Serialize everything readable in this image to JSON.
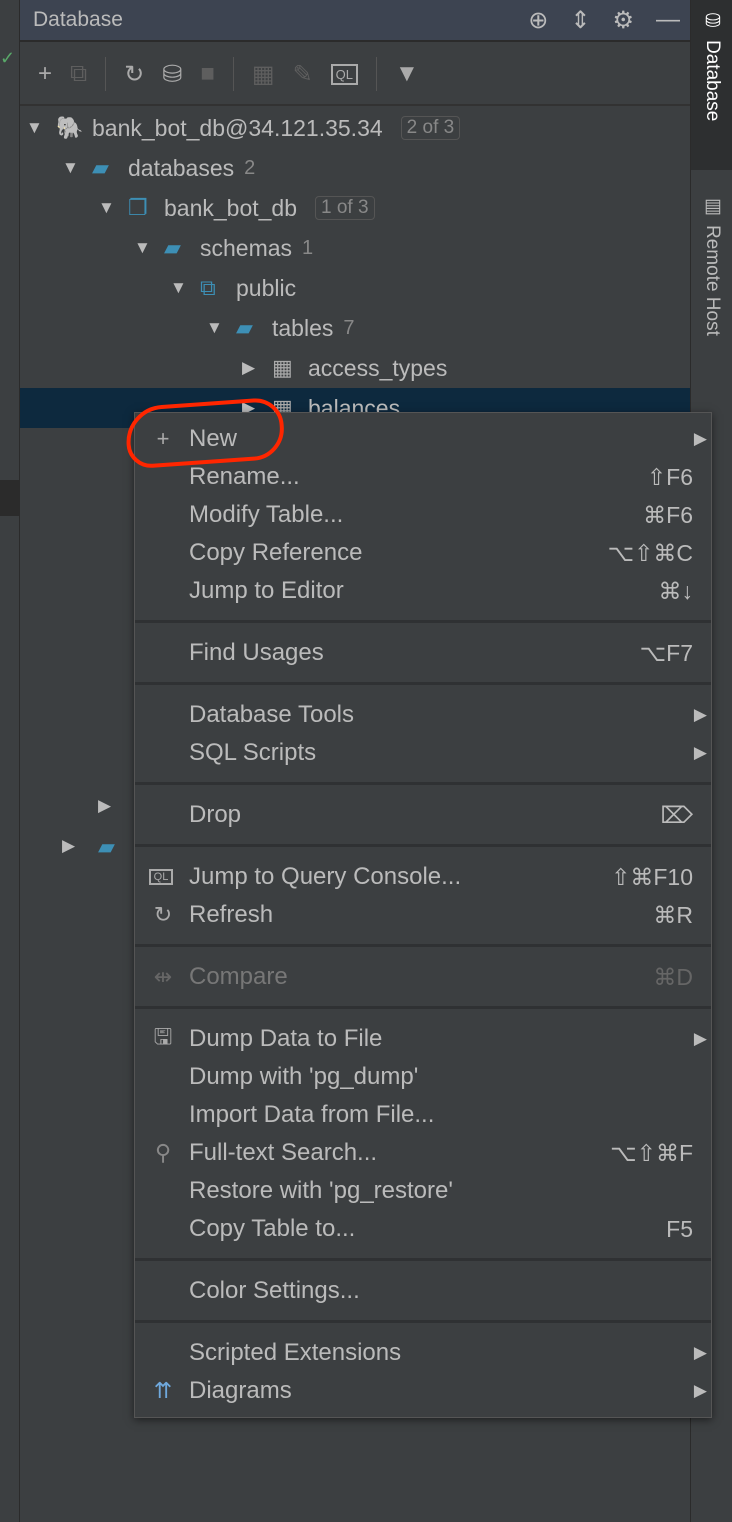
{
  "header": {
    "title": "Database"
  },
  "side_tabs": [
    "Database",
    "Remote Host"
  ],
  "tree": [
    {
      "label": "bank_bot_db@34.121.35.34",
      "badge": "2 of 3"
    },
    {
      "label": "databases",
      "count": "2"
    },
    {
      "label": "bank_bot_db",
      "badge": "1 of 3"
    },
    {
      "label": "schemas",
      "count": "1"
    },
    {
      "label": "public"
    },
    {
      "label": "tables",
      "count": "7"
    },
    {
      "label": "access_types"
    },
    {
      "label": "balances"
    }
  ],
  "menu": [
    {
      "label": "New",
      "submenu": true
    },
    {
      "label": "Rename...",
      "shortcut": "⇧F6"
    },
    {
      "label": "Modify Table...",
      "shortcut": "⌘F6"
    },
    {
      "label": "Copy Reference",
      "shortcut": "⌥⇧⌘C"
    },
    {
      "label": "Jump to Editor",
      "shortcut": "⌘↓"
    },
    {
      "label": "Find Usages",
      "shortcut": "⌥F7"
    },
    {
      "label": "Database Tools",
      "submenu": true
    },
    {
      "label": "SQL Scripts",
      "submenu": true
    },
    {
      "label": "Drop",
      "shortcut": "⌦"
    },
    {
      "label": "Jump to Query Console...",
      "shortcut": "⇧⌘F10"
    },
    {
      "label": "Refresh",
      "shortcut": "⌘R"
    },
    {
      "label": "Compare",
      "shortcut": "⌘D",
      "disabled": true
    },
    {
      "label": "Dump Data to File",
      "submenu": true
    },
    {
      "label": "Dump with 'pg_dump'"
    },
    {
      "label": "Import Data from File..."
    },
    {
      "label": "Full-text Search...",
      "shortcut": "⌥⇧⌘F"
    },
    {
      "label": "Restore with 'pg_restore'"
    },
    {
      "label": "Copy Table to...",
      "shortcut": "F5"
    },
    {
      "label": "Color Settings..."
    },
    {
      "label": "Scripted Extensions",
      "submenu": true
    },
    {
      "label": "Diagrams",
      "submenu": true
    }
  ],
  "annotation_color": "#ff2600"
}
